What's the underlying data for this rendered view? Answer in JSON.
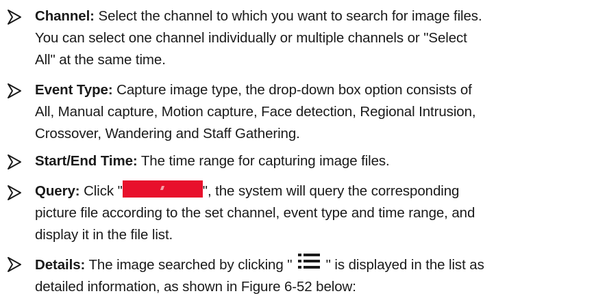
{
  "items": [
    {
      "label": "Channel:",
      "lines": [
        " Select the channel to which you want to search for image files.",
        "You can select one channel individually or multiple channels or \"Select",
        "All\" at the same time."
      ]
    },
    {
      "label": "Event Type:",
      "lines": [
        " Capture image type, the drop-down box option consists of",
        "All, Manual capture, Motion capture, Face detection, Regional Intrusion,",
        "Crossover, Wandering and Staff Gathering."
      ]
    },
    {
      "label": "Start/End Time:",
      "lines": [
        " The time range for capturing image files."
      ]
    },
    {
      "label": "Query:",
      "before": " Click \"",
      "after": "\", the system will query the corresponding",
      "lines": [
        "picture file according to the set channel, event type and time range, and",
        "display it in the file list."
      ],
      "button_color": "#e8102c"
    },
    {
      "label": "Details:",
      "before": " The image searched by clicking \" ",
      "after": " \" is displayed in the list as",
      "lines": [
        "detailed information, as shown in Figure 6-52 below:"
      ],
      "icon": "list-details-icon"
    }
  ]
}
